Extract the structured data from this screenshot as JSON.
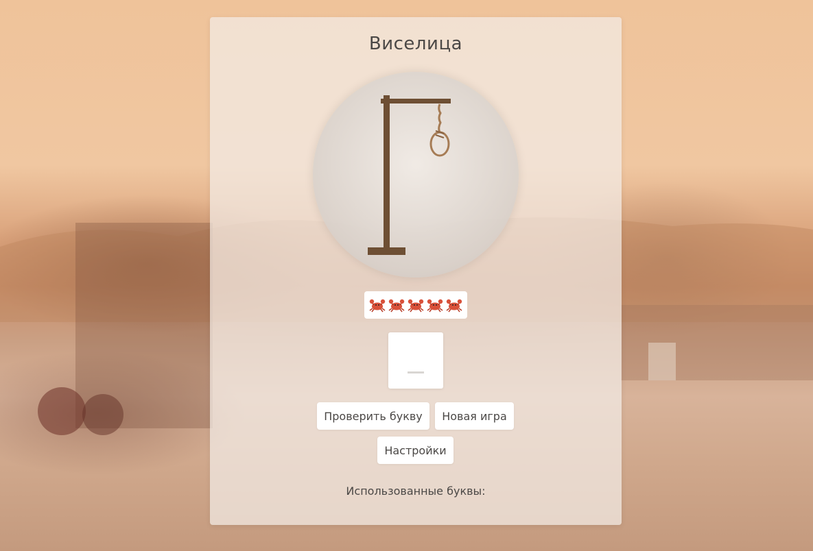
{
  "game": {
    "title": "Виселица",
    "lives": [
      "crab-icon",
      "crab-icon",
      "crab-icon",
      "crab-icon",
      "crab-icon"
    ],
    "word_slots": [
      "_"
    ],
    "buttons": {
      "check_letter": "Проверить букву",
      "new_game": "Новая игра",
      "settings": "Настройки"
    },
    "used_letters_label": "Использованные буквы:",
    "used_letters": ""
  },
  "colors": {
    "gallows_wood": "#6e4f34",
    "rope": "#a67c55",
    "text": "#4b4846"
  }
}
